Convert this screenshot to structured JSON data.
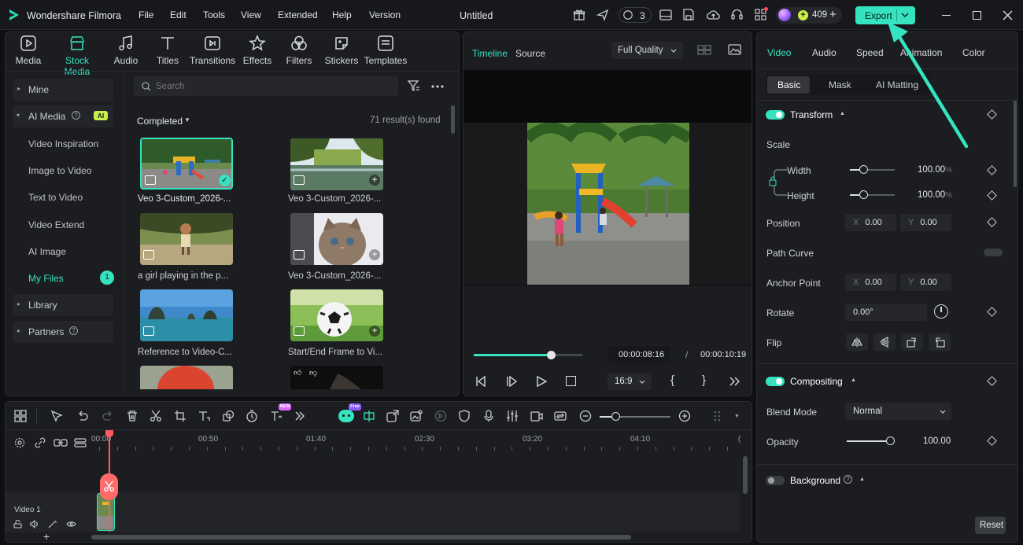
{
  "app": {
    "name": "Wondershare Filmora",
    "doc_title": "Untitled"
  },
  "menu": [
    "File",
    "Edit",
    "Tools",
    "View",
    "Extended",
    "Help",
    "Version"
  ],
  "topbar": {
    "collab_count": "3",
    "credits": "409",
    "export_label": "Export"
  },
  "toolbar": [
    {
      "label": "Media"
    },
    {
      "label": "Stock Media"
    },
    {
      "label": "Audio"
    },
    {
      "label": "Titles"
    },
    {
      "label": "Transitions"
    },
    {
      "label": "Effects"
    },
    {
      "label": "Filters"
    },
    {
      "label": "Stickers"
    },
    {
      "label": "Templates"
    }
  ],
  "sidebar": {
    "mine": "Mine",
    "ai_media": "AI Media",
    "ai_badge": "AI",
    "sub": [
      "Video Inspiration",
      "Image to Video",
      "Text to Video",
      "Video Extend",
      "AI Image"
    ],
    "my_files": "My Files",
    "my_files_count": "1",
    "library": "Library",
    "partners": "Partners"
  },
  "browser": {
    "search_placeholder": "Search",
    "filter": "Completed",
    "results": "71 result(s) found",
    "items": [
      "Veo 3-Custom_2026-...",
      "Veo 3-Custom_2026-...",
      "a girl playing in the p...",
      "Veo 3-Custom_2026-...",
      "Reference to Video-C...",
      "Start/End Frame to Vi..."
    ]
  },
  "preview": {
    "tab_timeline": "Timeline",
    "tab_source": "Source",
    "quality": "Full Quality",
    "current_time": "00:00:08:16",
    "separator": "/",
    "total_time": "00:00:10:19",
    "aspect": "16:9",
    "progress": 0.71
  },
  "props": {
    "tabs": [
      "Video",
      "Audio",
      "Speed",
      "Animation",
      "Color"
    ],
    "subtabs": [
      "Basic",
      "Mask",
      "AI Matting"
    ],
    "transform": "Transform",
    "scale": "Scale",
    "width": "Width",
    "width_val": "100.00",
    "height": "Height",
    "height_val": "100.00",
    "pct": "%",
    "position": "Position",
    "pos_x": "0.00",
    "pos_y": "0.00",
    "path_curve": "Path Curve",
    "anchor_point": "Anchor Point",
    "anchor_x": "0.00",
    "anchor_y": "0.00",
    "rotate": "Rotate",
    "rotate_val": "0.00°",
    "flip": "Flip",
    "compositing": "Compositing",
    "blend_mode": "Blend Mode",
    "blend_val": "Normal",
    "opacity": "Opacity",
    "opacity_val": "100.00",
    "background": "Background",
    "reset": "Reset",
    "axis_x": "X",
    "axis_y": "Y"
  },
  "timeline": {
    "ruler": [
      "00:00",
      "00:50",
      "01:40",
      "02:30",
      "03:20",
      "04:10"
    ],
    "track_label": "Video 1",
    "new_badge": "NEW",
    "free_badge": "Free"
  },
  "colors": {
    "accent": "#35e3c0",
    "playhead": "#ff5a5f"
  }
}
